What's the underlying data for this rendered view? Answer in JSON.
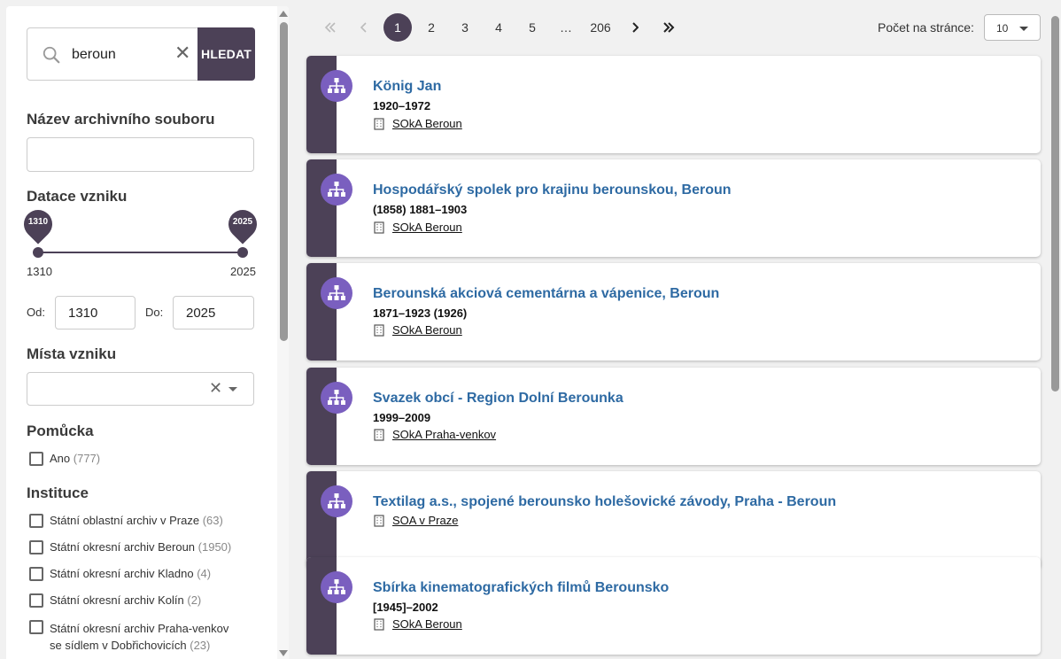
{
  "search": {
    "query": "beroun",
    "button_label": "HLEDAT"
  },
  "filters": {
    "fund_name": {
      "title": "Název archivního souboru",
      "value": ""
    },
    "date": {
      "title": "Datace vzniku",
      "min_pin": "1310",
      "max_pin": "2025",
      "min_label": "1310",
      "max_label": "2025",
      "from_label": "Od:",
      "to_label": "Do:",
      "from_value": "1310",
      "to_value": "2025"
    },
    "places": {
      "title": "Místa vzniku",
      "value": ""
    },
    "aid": {
      "title": "Pomůcka",
      "items": [
        {
          "label": "Ano",
          "count": "(777)"
        }
      ]
    },
    "institution": {
      "title": "Instituce",
      "items": [
        {
          "label": "Státní oblastní archiv v Praze",
          "count": "(63)"
        },
        {
          "label": "Státní okresní archiv Beroun",
          "count": "(1950)"
        },
        {
          "label": "Státní okresní archiv Kladno",
          "count": "(4)"
        },
        {
          "label": "Státní okresní archiv Kolín",
          "count": "(2)"
        },
        {
          "label": "Státní okresní archiv Praha-venkov se sídlem v Dobřichovicích",
          "count": "(23)"
        }
      ]
    }
  },
  "pagination": {
    "pages": [
      "1",
      "2",
      "3",
      "4",
      "5",
      "…",
      "206"
    ],
    "current": "1",
    "per_page_label": "Počet na stránce:",
    "per_page_value": "10"
  },
  "results": [
    {
      "title": "König Jan",
      "date": "1920–1972",
      "institution": "SOkA Beroun"
    },
    {
      "title": "Hospodářský spolek pro krajinu berounskou, Beroun",
      "date": "(1858) 1881–1903",
      "institution": "SOkA Beroun"
    },
    {
      "title": "Berounská akciová cementárna a vápenice, Beroun",
      "date": "1871–1923 (1926)",
      "institution": "SOkA Beroun"
    },
    {
      "title": "Svazek obcí - Region Dolní Berounka",
      "date": "1999–2009",
      "institution": "SOkA Praha-venkov"
    },
    {
      "title": "Textilag a.s., spojené berounsko holešovické závody, Praha - Beroun",
      "date": "",
      "institution": "SOA v Praze"
    },
    {
      "title": "Sbírka kinematografických filmů Berounsko",
      "date": "[1945]–2002",
      "institution": "SOkA Beroun"
    }
  ],
  "colors": {
    "accent": "#4c4157",
    "link": "#2e6aa3",
    "icon_bg": "#7a5fbf"
  },
  "icons": {
    "search": "search-icon",
    "clear": "clear-icon",
    "hierarchy": "hierarchy-icon",
    "building": "building-icon"
  }
}
